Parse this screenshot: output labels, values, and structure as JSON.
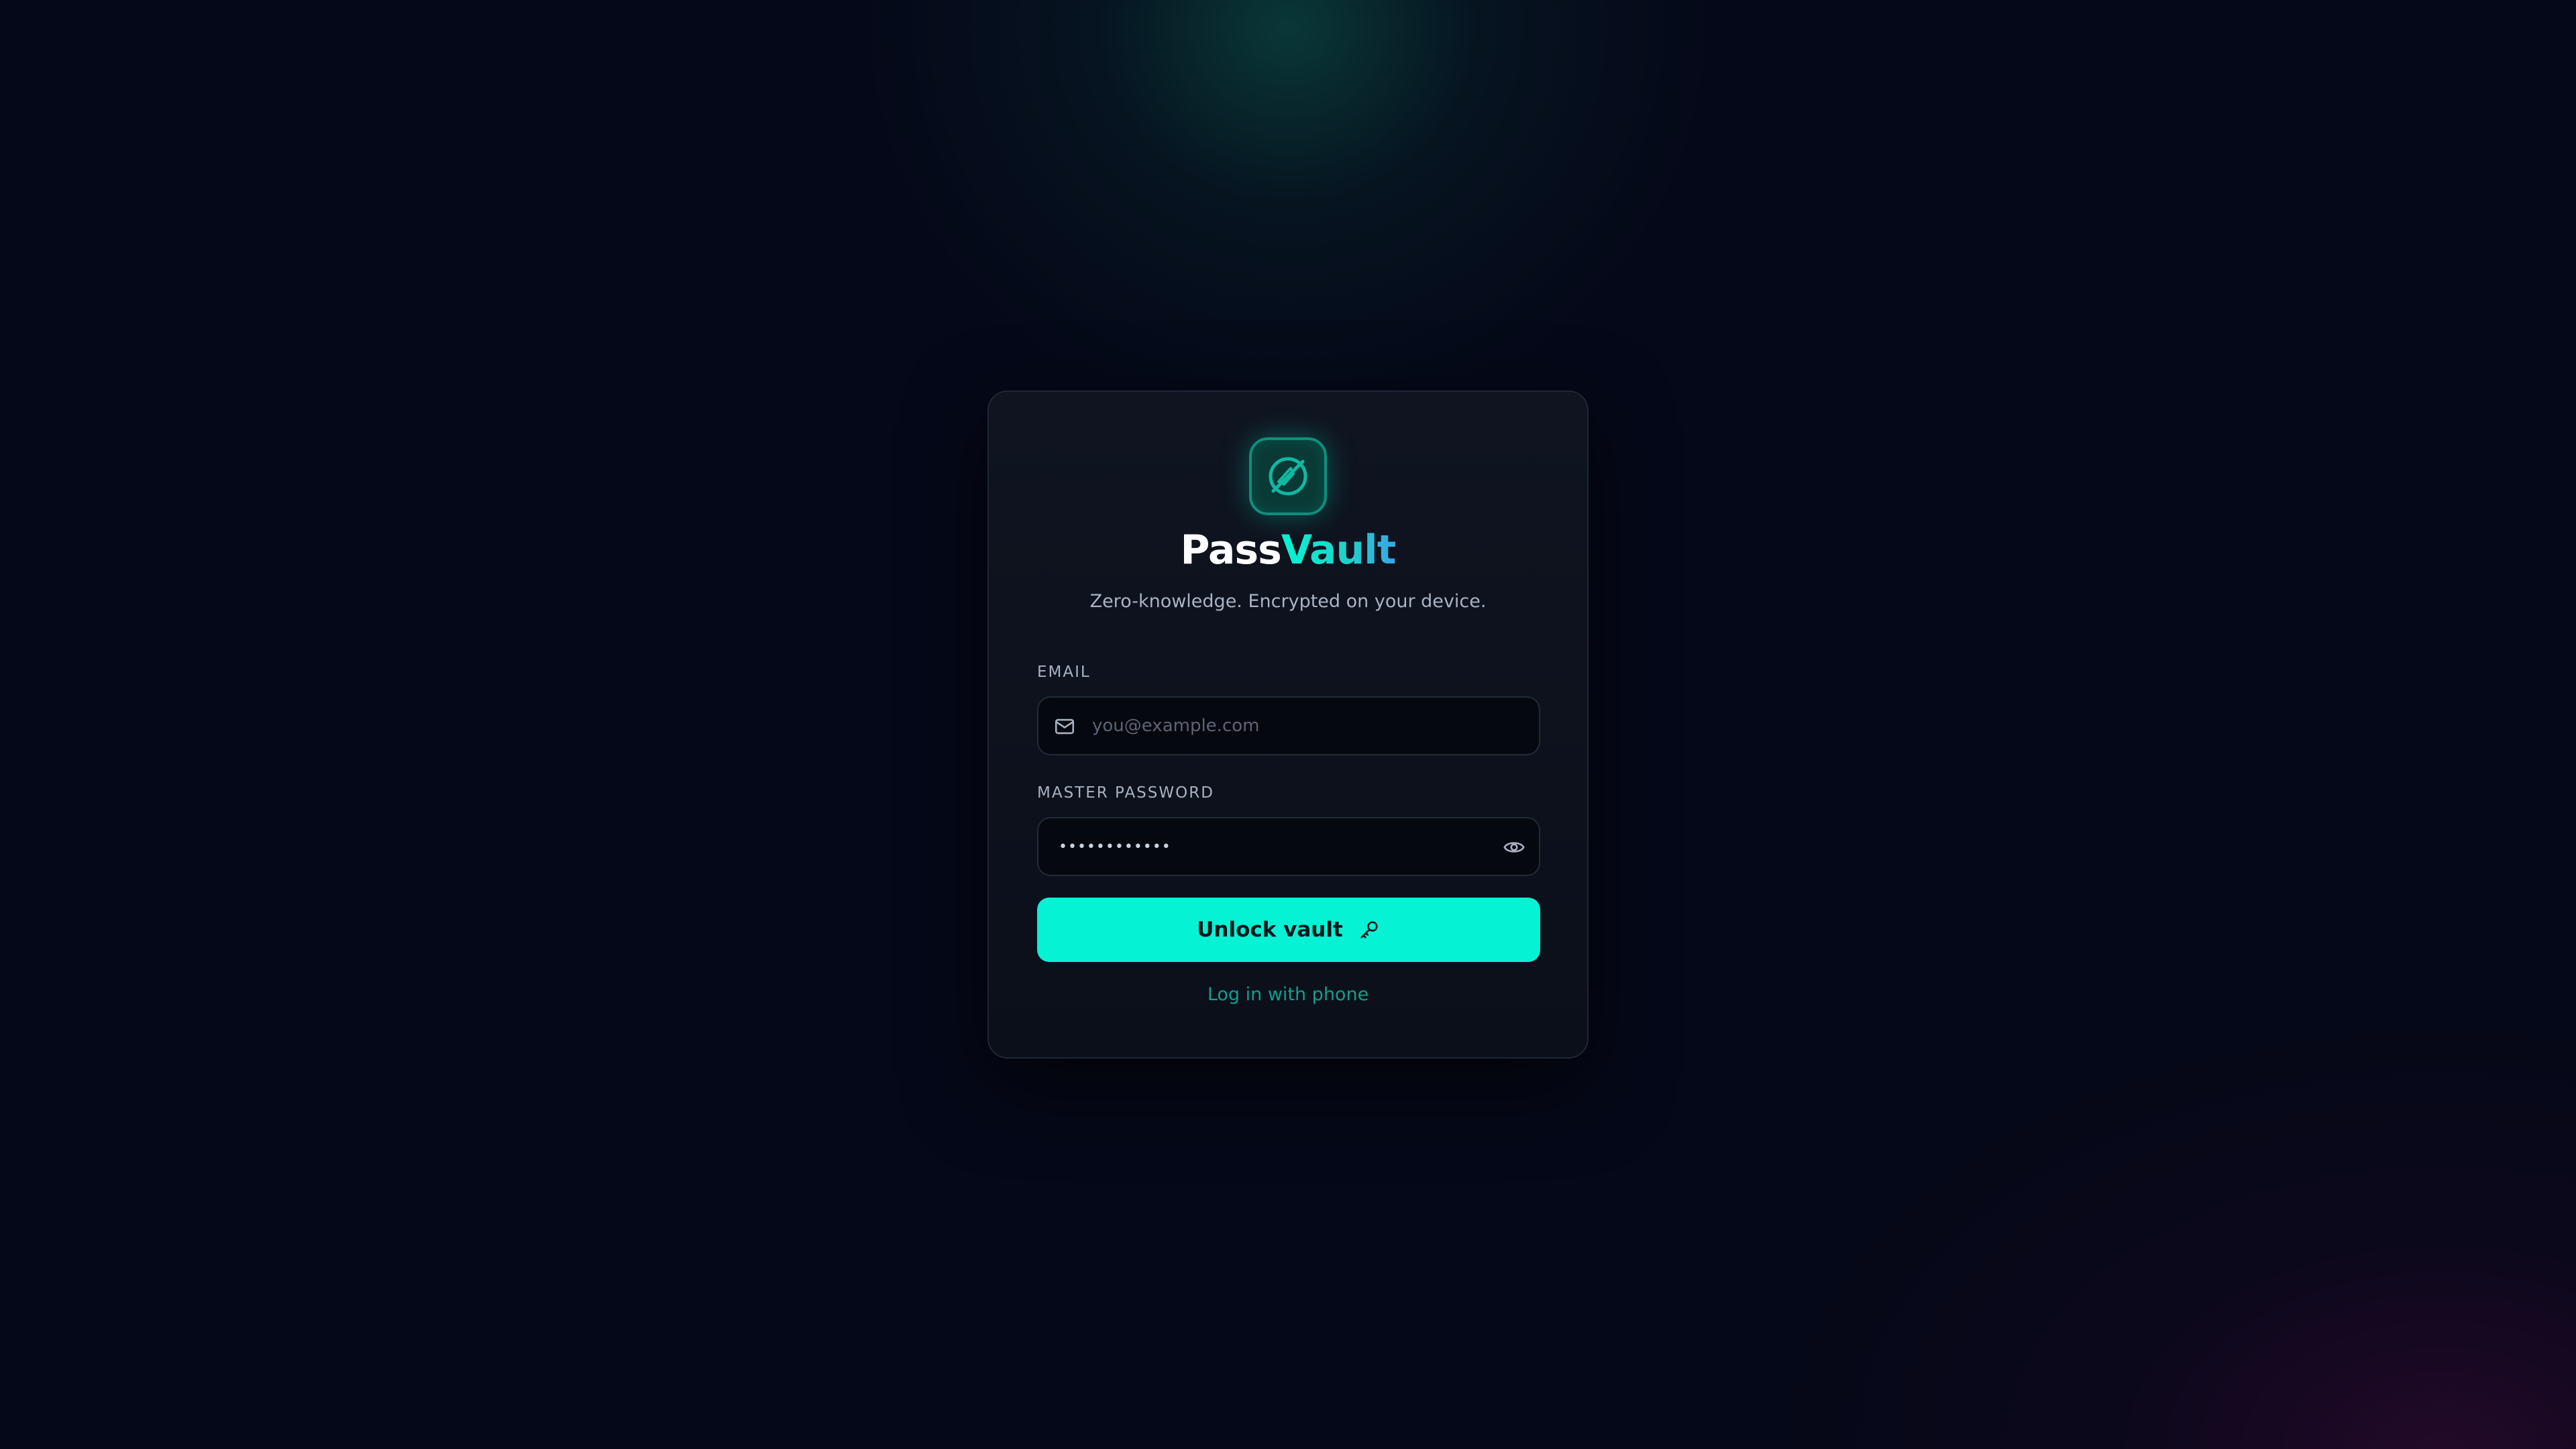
{
  "brand": {
    "name_part1": "Pass",
    "name_part2": "Vault",
    "tagline": "Zero-knowledge. Encrypted on your device."
  },
  "email": {
    "label": "EMAIL",
    "placeholder": "you@example.com",
    "value": ""
  },
  "password": {
    "label": "MASTER PASSWORD",
    "value": "••••••••••••"
  },
  "actions": {
    "unlock_label": "Unlock vault",
    "phone_login_label": "Log in with phone"
  },
  "icons": {
    "logo": "shield-slash-icon",
    "email": "mail-icon",
    "reveal": "eye-icon",
    "unlock": "key-icon"
  },
  "colors": {
    "background": "#050818",
    "card": "#0d121d",
    "accent": "#05f2d4",
    "accent_dark": "#0f9f8c",
    "text_muted": "#a9b3c4"
  }
}
